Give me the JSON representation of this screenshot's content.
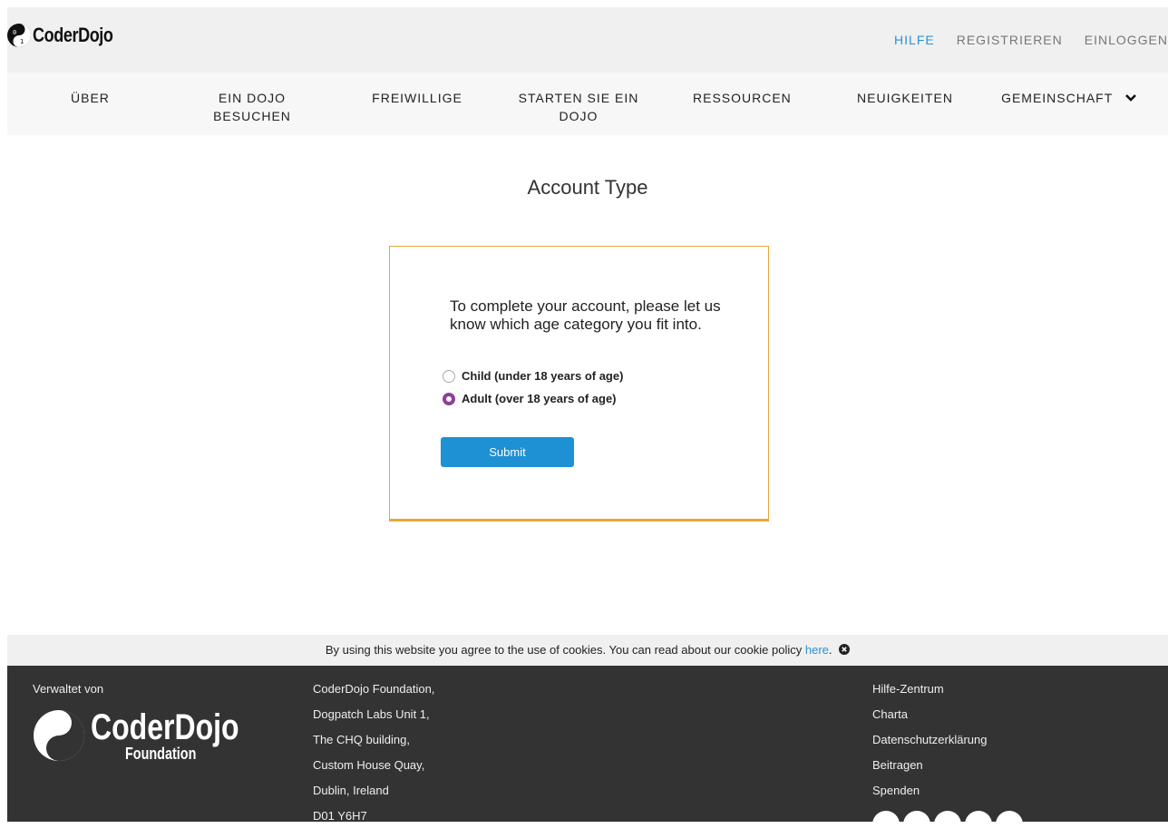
{
  "brand": {
    "name": "CoderDojo"
  },
  "top_links": [
    {
      "label": "HILFE",
      "active": true
    },
    {
      "label": "REGISTRIEREN",
      "active": false
    },
    {
      "label": "EINLOGGEN",
      "active": false
    }
  ],
  "nav": [
    {
      "line1": "ÜBER",
      "line2": ""
    },
    {
      "line1": "EIN DOJO BESUCHEN",
      "line2": ""
    },
    {
      "line1": "FREIWILLIGE",
      "line2": ""
    },
    {
      "line1": "STARTEN SIE EIN",
      "line2": "DOJO"
    },
    {
      "line1": "RESSOURCEN",
      "line2": ""
    },
    {
      "line1": "NEUIGKEITEN",
      "line2": ""
    },
    {
      "line1": "GEMEINSCHAFT",
      "line2": ""
    }
  ],
  "main": {
    "title": "Account Type",
    "prompt": "To complete your account, please let us know which age category you fit into.",
    "options": [
      {
        "label": "Child (under 18 years of age)",
        "selected": false
      },
      {
        "label": "Adult (over 18 years of age)",
        "selected": true
      }
    ],
    "submit_label": "Submit"
  },
  "cookie": {
    "text": "By using this website you agree to the use of cookies. You can read about our cookie policy ",
    "link": "here",
    "after": "."
  },
  "footer": {
    "managed_by": "Verwaltet von",
    "logo_line1": "CoderDojo",
    "logo_line2": "Foundation",
    "address": [
      "CoderDojo Foundation,",
      "Dogpatch Labs Unit 1,",
      "The CHQ building,",
      "Custom House Quay,",
      "Dublin, Ireland",
      "D01 Y6H7"
    ],
    "links": [
      "Hilfe-Zentrum",
      "Charta",
      "Datenschutzerklärung",
      "Beitragen",
      "Spenden"
    ],
    "social_icons": [
      "twitter-icon",
      "facebook-icon",
      "google-plus-icon",
      "linkedin-icon",
      "email-icon"
    ]
  },
  "colors": {
    "accent": "#2b93cf",
    "card_border": "#e6a73a",
    "radio_selected": "#8f3f97",
    "footer_bg": "#333333",
    "button": "#1e90d4"
  }
}
